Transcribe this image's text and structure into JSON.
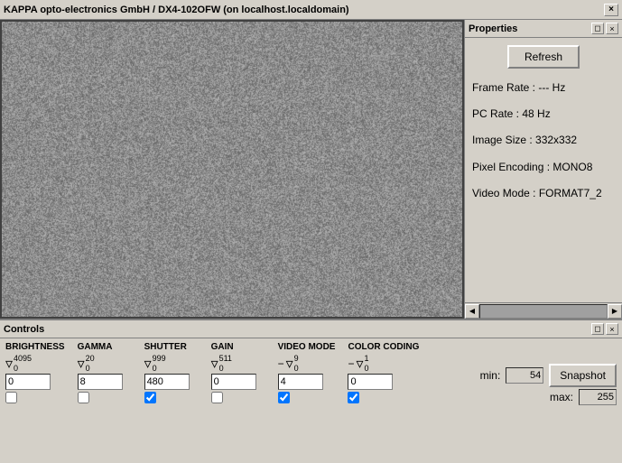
{
  "titleBar": {
    "title": "KAPPA opto-electronics GmbH / DX4-102OFW (on localhost.localdomain)",
    "closeLabel": "×"
  },
  "propertiesPanel": {
    "title": "Properties",
    "refreshButton": "Refresh",
    "frameRate": "Frame Rate : --- Hz",
    "pcRate": "PC Rate : 48 Hz",
    "imageSize": "Image Size : 332x332",
    "pixelEncoding": "Pixel Encoding : MONO8",
    "videoMode": "Video Mode : FORMAT7_2"
  },
  "controlsPanel": {
    "title": "Controls",
    "brightness": {
      "label": "BRIGHTNESS",
      "max": "4095",
      "min": "0",
      "value": "0"
    },
    "gamma": {
      "label": "GAMMA",
      "max": "20",
      "min": "0",
      "value": "8"
    },
    "shutter": {
      "label": "SHUTTER",
      "max": "999",
      "min": "0",
      "value": "480"
    },
    "gain": {
      "label": "GAIN",
      "max": "511",
      "min": "0",
      "value": "0"
    },
    "videoMode": {
      "label": "VIDEO MODE",
      "max": "9",
      "min": "0",
      "value": "4"
    },
    "colorCoding": {
      "label": "COLOR CODING",
      "max": "1",
      "min": "0",
      "value": "0"
    },
    "min": {
      "label": "min:",
      "value": "54"
    },
    "max": {
      "label": "max:",
      "value": "255"
    },
    "snapshotButton": "Snapshot"
  }
}
